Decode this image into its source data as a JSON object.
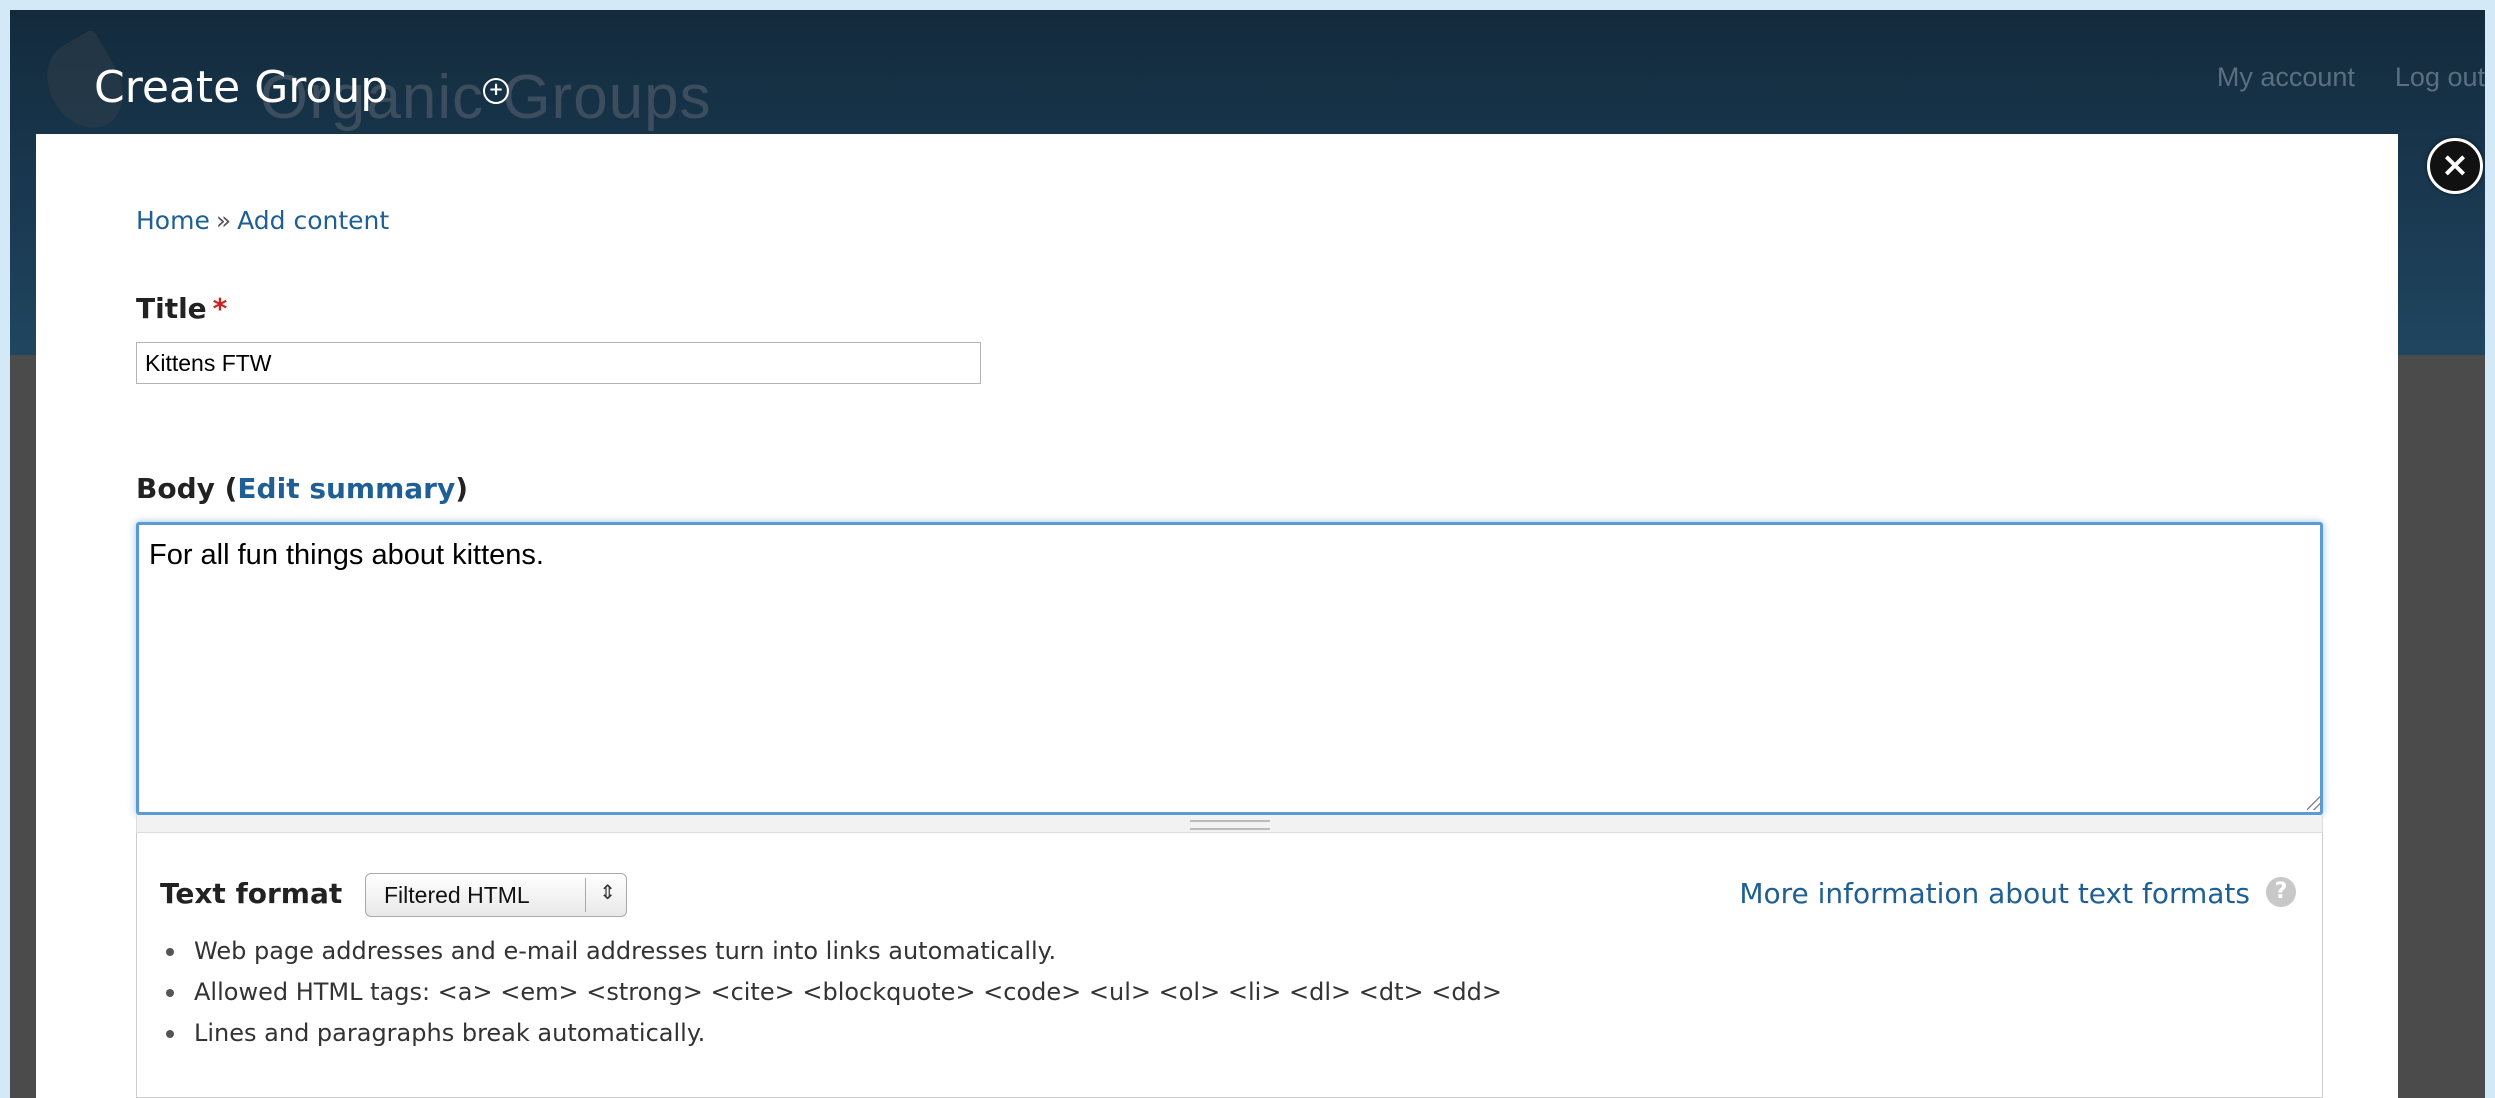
{
  "header": {
    "site_name": "Organic Groups",
    "user_links": [
      "My account",
      "Log out"
    ]
  },
  "modal": {
    "title": "Create Group",
    "title_toggle_icon": "plus-circle-icon",
    "close_icon": "close-icon"
  },
  "breadcrumb": {
    "home": "Home",
    "separator": "»",
    "current": "Add content"
  },
  "form": {
    "title_label": "Title",
    "required_marker": "*",
    "title_value": "Kittens FTW",
    "body_label": "Body (",
    "edit_summary_link": "Edit summary",
    "body_label_close": ")",
    "body_value": "For all fun things about kittens."
  },
  "text_format": {
    "label": "Text format",
    "selected": "Filtered HTML",
    "more_info_link": "More information about text formats",
    "help_icon": "?",
    "tips": [
      "Web page addresses and e-mail addresses turn into links automatically.",
      "Allowed HTML tags: <a> <em> <strong> <cite> <blockquote> <code> <ul> <ol> <li> <dl> <dt> <dd>",
      "Lines and paragraphs break automatically."
    ]
  },
  "colors": {
    "link": "#1f5f95",
    "header_bg": "#132a3c",
    "focus": "#5b9bd5",
    "required": "#cc2222"
  }
}
